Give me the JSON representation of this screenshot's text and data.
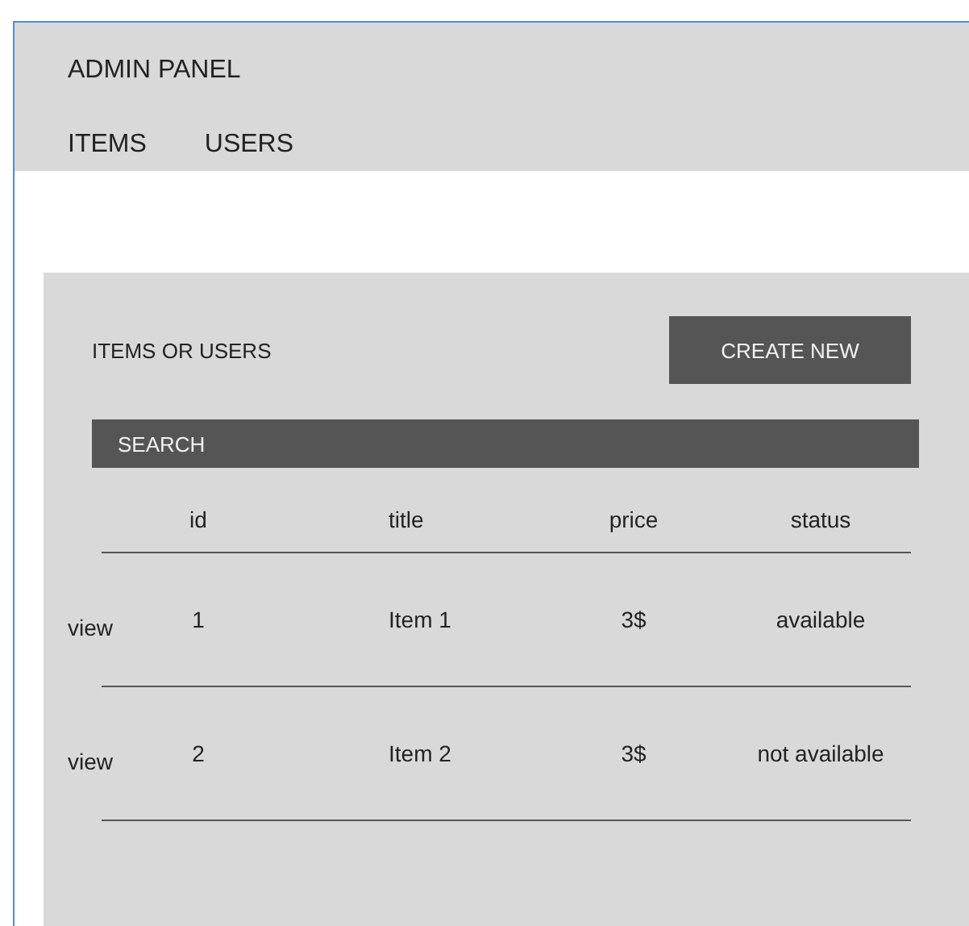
{
  "app_title": "ADMIN PANEL",
  "nav": [
    {
      "label": "ITEMS"
    },
    {
      "label": "USERS"
    }
  ],
  "panel": {
    "title": "ITEMS OR USERS",
    "create_button": "CREATE NEW",
    "search": {
      "placeholder": "SEARCH"
    }
  },
  "table": {
    "columns": [
      "id",
      "title",
      "price",
      "status"
    ],
    "rows": [
      {
        "action": "view",
        "cells": [
          "1",
          "Item 1",
          "3$",
          "available"
        ]
      },
      {
        "action": "view",
        "cells": [
          "2",
          "Item 2",
          "3$",
          "not available"
        ]
      }
    ]
  }
}
